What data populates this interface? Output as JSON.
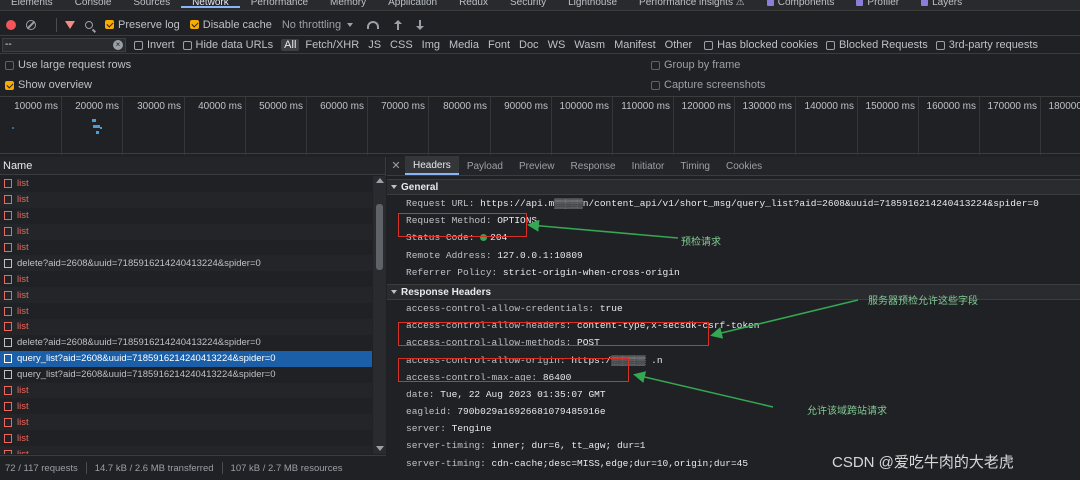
{
  "devtools": {
    "tabs": [
      {
        "label": "Elements"
      },
      {
        "label": "Console"
      },
      {
        "label": "Sources"
      },
      {
        "label": "Network"
      },
      {
        "label": "Performance"
      },
      {
        "label": "Memory"
      },
      {
        "label": "Application"
      },
      {
        "label": "Redux"
      },
      {
        "label": "Security"
      },
      {
        "label": "Lighthouse"
      },
      {
        "label": "Performance insights ⚠"
      },
      {
        "label": "Components"
      },
      {
        "label": "Profiler"
      },
      {
        "label": "Layers"
      }
    ],
    "active_tab": "Network"
  },
  "toolbar": {
    "preserve_log": "Preserve log",
    "disable_cache": "Disable cache",
    "throttling": "No throttling"
  },
  "filter": {
    "value": "--",
    "invert": "Invert",
    "hide_data_urls": "Hide data URLs",
    "types": [
      "All",
      "Fetch/XHR",
      "JS",
      "CSS",
      "Img",
      "Media",
      "Font",
      "Doc",
      "WS",
      "Wasm",
      "Manifest",
      "Other"
    ],
    "has_blocked_cookies": "Has blocked cookies",
    "blocked_requests": "Blocked Requests",
    "third_party": "3rd-party requests"
  },
  "options": {
    "large_rows": "Use large request rows",
    "show_overview": "Show overview",
    "group_by_frame": "Group by frame",
    "capture_screenshots": "Capture screenshots"
  },
  "overview": {
    "ticks": [
      "10000 ms",
      "20000 ms",
      "30000 ms",
      "40000 ms",
      "50000 ms",
      "60000 ms",
      "70000 ms",
      "80000 ms",
      "90000 ms",
      "100000 ms",
      "110000 ms",
      "120000 ms",
      "130000 ms",
      "140000 ms",
      "150000 ms",
      "160000 ms",
      "170000 ms",
      "180000 ms"
    ]
  },
  "requests": {
    "header": "Name",
    "rows": [
      {
        "name": "list",
        "status": "error"
      },
      {
        "name": "list",
        "status": "error"
      },
      {
        "name": "list",
        "status": "error"
      },
      {
        "name": "list",
        "status": "error"
      },
      {
        "name": "list",
        "status": "error"
      },
      {
        "name": "delete?aid=2608&uuid=7185916214240413224&spider=0",
        "status": "ok"
      },
      {
        "name": "list",
        "status": "error"
      },
      {
        "name": "list",
        "status": "error"
      },
      {
        "name": "list",
        "status": "error"
      },
      {
        "name": "list",
        "status": "error"
      },
      {
        "name": "delete?aid=2608&uuid=7185916214240413224&spider=0",
        "status": "ok"
      },
      {
        "name": "query_list?aid=2608&uuid=7185916214240413224&spider=0",
        "status": "selected"
      },
      {
        "name": "query_list?aid=2608&uuid=7185916214240413224&spider=0",
        "status": "ok"
      },
      {
        "name": "list",
        "status": "error"
      },
      {
        "name": "list",
        "status": "error"
      },
      {
        "name": "list",
        "status": "error"
      },
      {
        "name": "list",
        "status": "error"
      },
      {
        "name": "list",
        "status": "error"
      }
    ]
  },
  "status": {
    "requests": "72 / 117 requests",
    "transferred": "14.7 kB / 2.6 MB transferred",
    "resources": "107 kB / 2.7 MB resources"
  },
  "detail": {
    "tabs": [
      "Headers",
      "Payload",
      "Preview",
      "Response",
      "Initiator",
      "Timing",
      "Cookies"
    ],
    "active_tab": "Headers",
    "general": {
      "title": "General",
      "items": [
        {
          "key": "Request URL:",
          "value": "https://api.m▒▒▒▒▒n/content_api/v1/short_msg/query_list?aid=2608&uuid=7185916214240413224&spider=0"
        },
        {
          "key": "Request Method:",
          "value": "OPTIONS"
        },
        {
          "key": "Status Code:",
          "value": "204"
        },
        {
          "key": "Remote Address:",
          "value": "127.0.0.1:10809"
        },
        {
          "key": "Referrer Policy:",
          "value": "strict-origin-when-cross-origin"
        }
      ]
    },
    "response": {
      "title": "Response Headers",
      "items": [
        {
          "key": "access-control-allow-credentials:",
          "value": "true"
        },
        {
          "key": "access-control-allow-headers:",
          "value": "content-type,x-secsdk-csrf-token"
        },
        {
          "key": "access-control-allow-methods:",
          "value": "POST"
        },
        {
          "key": "access-control-allow-origin:",
          "value": "https:/▒▒▒▒▒▒ .n"
        },
        {
          "key": "access-control-max-age:",
          "value": "86400"
        },
        {
          "key": "date:",
          "value": "Tue, 22 Aug 2023 01:35:07 GMT"
        },
        {
          "key": "eagleid:",
          "value": "790b029a16926681079485916e"
        },
        {
          "key": "server:",
          "value": "Tengine"
        },
        {
          "key": "server-timing:",
          "value": "inner; dur=6, tt_agw; dur=1"
        },
        {
          "key": "server-timing:",
          "value": "cdn-cache;desc=MISS,edge;dur=10,origin;dur=45"
        }
      ]
    }
  },
  "annotations": {
    "preflight": "预检请求",
    "allow_fields": "服务器预检允许这些字段",
    "allow_origin": "允许该域跨站请求"
  },
  "watermark": "CSDN @爱吃牛肉的大老虎",
  "colors": {
    "accent": "#8ab4f8",
    "error": "#ee675c",
    "selected": "#1a5fa8",
    "annotation": "#81c995",
    "highlight": "#d93025"
  }
}
